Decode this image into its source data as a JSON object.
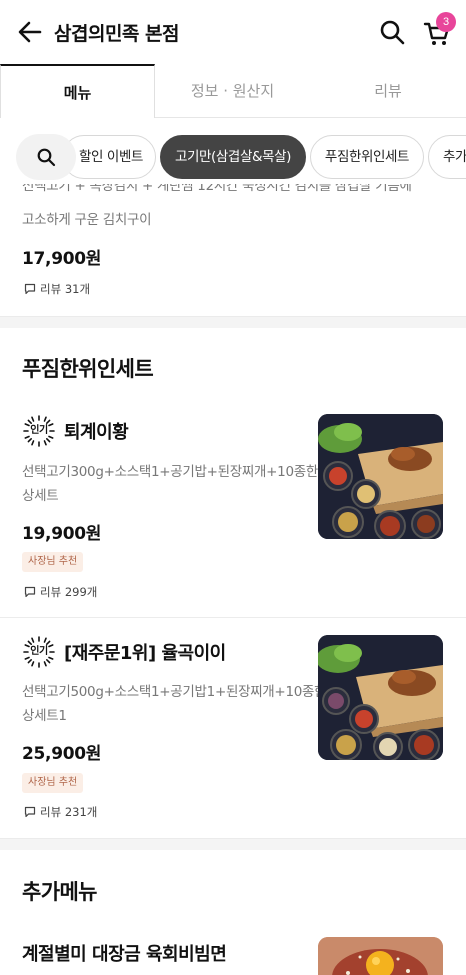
{
  "header": {
    "title": "삼겹의민족 본점",
    "cart_count": "3"
  },
  "tabs": [
    {
      "label": "메뉴",
      "active": true
    },
    {
      "label": "정보 · 원산지",
      "active": false
    },
    {
      "label": "리뷰",
      "active": false
    }
  ],
  "chips": [
    {
      "label": "할인 이벤트",
      "active": false
    },
    {
      "label": "고기만(삼겹살&목살)",
      "active": true
    },
    {
      "label": "푸짐한위인세트",
      "active": false
    },
    {
      "label": "추가",
      "active": false
    }
  ],
  "partial_item": {
    "desc_top": "선택고기 + 폭장김치 + 계란찜 12시간 숙성시킨 김치를 삼겹살 기름에",
    "desc_bottom": "고소하게 구운 김치구이",
    "price": "17,900원",
    "reviews": "리뷰 31개"
  },
  "section1": {
    "title": "푸짐한위인세트",
    "items": [
      {
        "badge": "인기",
        "name": "퇴계이황",
        "desc1": "선택고기300g+소스택1+공기밥+된장찌개+10종한",
        "desc2": "상세트",
        "price": "19,900원",
        "owner_badge": "사장님 추천",
        "reviews": "리뷰 299개"
      },
      {
        "badge": "인기",
        "name": "[재주문1위] 율곡이이",
        "desc1": "선택고기500g+소스택1+공기밥1+된장찌개+10종한",
        "desc2": "상세트1",
        "price": "25,900원",
        "owner_badge": "사장님 추천",
        "reviews": "리뷰 231개"
      }
    ]
  },
  "section2": {
    "title": "추가메뉴",
    "items": [
      {
        "name": "계절별미 대장금 육회비빔면"
      }
    ]
  }
}
